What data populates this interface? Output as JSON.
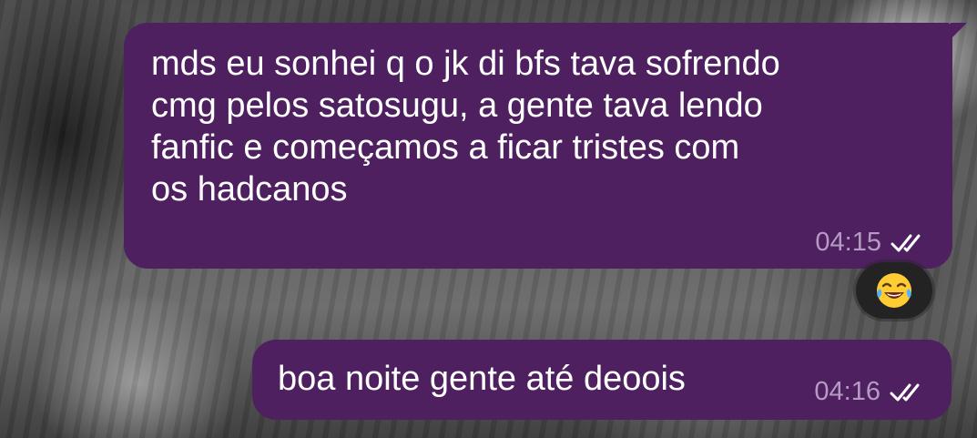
{
  "messages": [
    {
      "text": "mds eu sonhei q o jk di bfs tava sofrendo\ncmg pelos satosugu, a gente tava lendo\nfanfic e começamos a ficar tristes com\nos hadcanos",
      "time": "04:15",
      "status_icon": "double-check-icon"
    },
    {
      "text": "boa noite gente até deoois",
      "time": "04:16",
      "status_icon": "double-check-icon"
    }
  ],
  "reaction": {
    "emoji_name": "face-with-tears-of-joy-icon"
  },
  "colors": {
    "bubble": "#4f2060",
    "meta_text": "#b59bc4",
    "message_text": "#ffffff",
    "reaction_bg": "#232323"
  }
}
